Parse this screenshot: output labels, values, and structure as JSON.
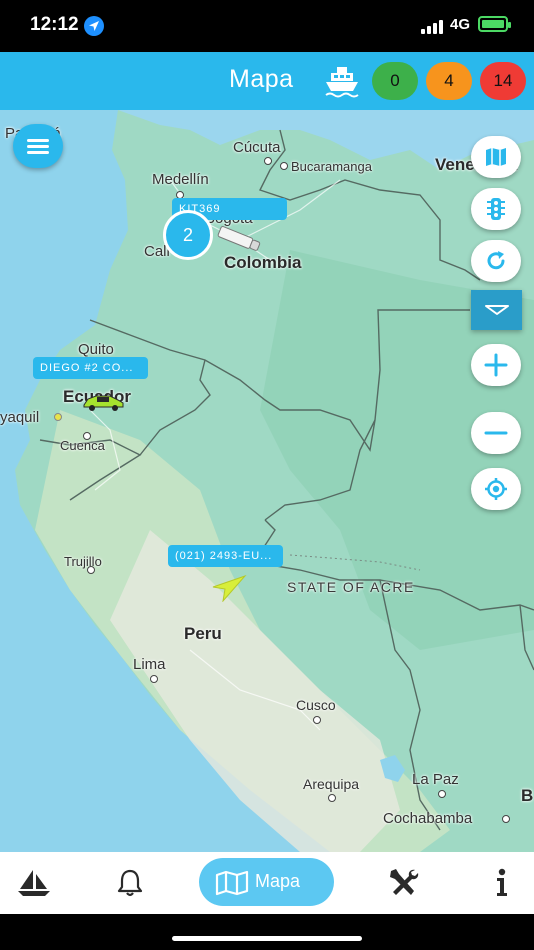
{
  "status_bar": {
    "time": "12:12",
    "network": "4G"
  },
  "header": {
    "title": "Mapa",
    "counts": {
      "green": "0",
      "orange": "4",
      "red": "14"
    },
    "colors": {
      "bar": "#2ab8ec",
      "green": "#3db04a",
      "orange": "#f7941d",
      "red": "#ef3b35"
    }
  },
  "map": {
    "places": {
      "panama": "Panamá",
      "cucuta": "Cúcuta",
      "bucaramanga": "Bucaramanga",
      "venezuela": "Venezuela",
      "medellin": "Medellín",
      "bogota": "Bogotá",
      "cali": "Cali",
      "colombia": "Colombia",
      "quito": "Quito",
      "ecuador": "Ecuador",
      "guayaquil": "yaquil",
      "cuenca": "Cuenca",
      "trujillo": "Trujillo",
      "acre": "STATE OF ACRE",
      "peru": "Peru",
      "lima": "Lima",
      "cusco": "Cusco",
      "arequipa": "Arequipa",
      "lapaz": "La Paz",
      "cochabamba": "Cochabamba",
      "bolivia": "B"
    },
    "vehicle_labels": {
      "colombia": "KIT369",
      "ecuador": "DIEGO #2 CO...",
      "peru": "(021) 2493-EU..."
    },
    "cluster_count": "2",
    "controls": [
      "map-layers-icon",
      "traffic-light-icon",
      "refresh-icon",
      "collapse-icon",
      "zoom-in-icon",
      "zoom-out-icon",
      "my-location-icon"
    ]
  },
  "tabbar": {
    "tabs": [
      "sailboat-icon",
      "bell-icon",
      "map-icon",
      "tools-icon",
      "info-icon"
    ],
    "active_label": "Mapa"
  }
}
